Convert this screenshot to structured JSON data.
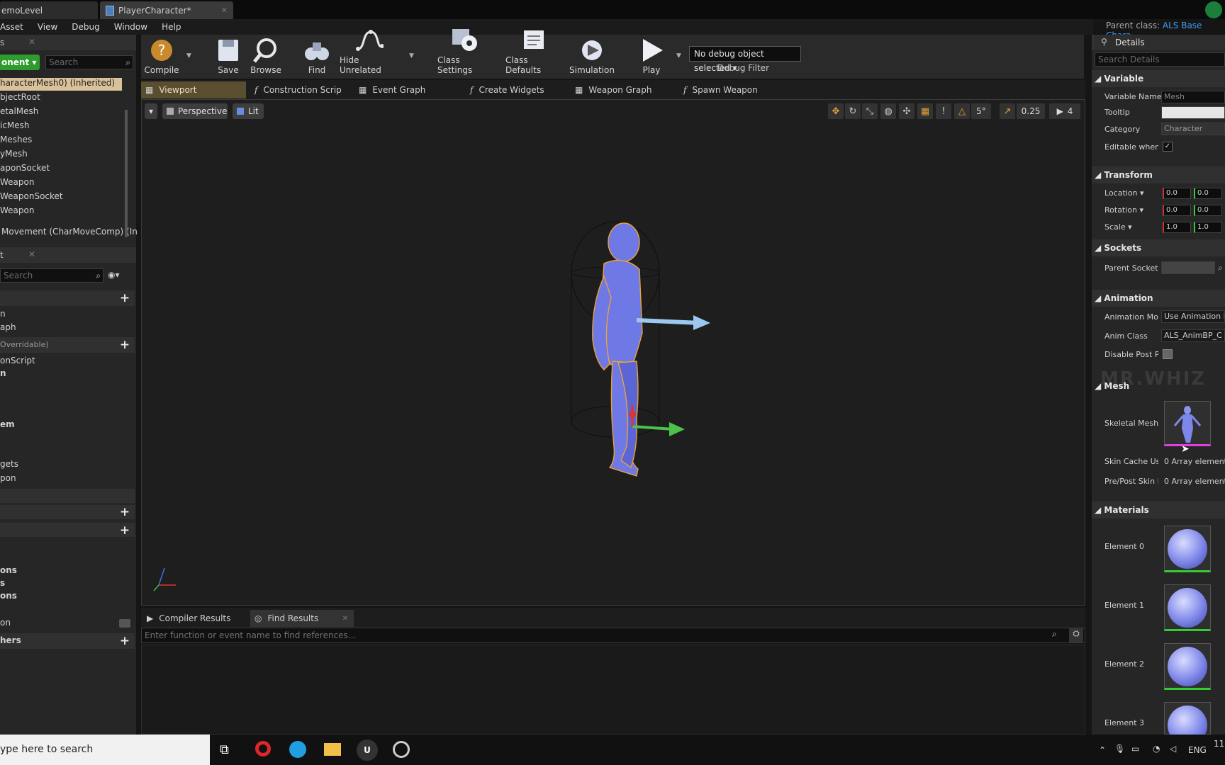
{
  "tabs": {
    "level": "emoLevel",
    "blueprint": "PlayerCharacter*"
  },
  "menu": [
    "Asset",
    "View",
    "Debug",
    "Window",
    "Help"
  ],
  "parent_class": {
    "label": "Parent class:",
    "value": "ALS Base Chara"
  },
  "components": {
    "header": "s",
    "add_button": "onent",
    "search_placeholder": "Search",
    "items": [
      "haracterMesh0) (Inherited)",
      "bjectRoot",
      "etalMesh",
      "icMesh",
      "Meshes",
      "yMesh",
      "aponSocket",
      "Weapon",
      "WeaponSocket",
      "Weapon",
      "Movement (CharMoveComp) (In"
    ]
  },
  "my_blueprint": {
    "header": "t",
    "search_placeholder": "Search",
    "items": [
      "n",
      "aph",
      "Overridable)",
      "onScript",
      "n",
      "em",
      "gets",
      "pon",
      "ons",
      "s",
      "ons",
      "on",
      "hers"
    ]
  },
  "toolbar": {
    "compile": "Compile",
    "save": "Save",
    "browse": "Browse",
    "find": "Find",
    "hide_unrelated": "Hide Unrelated",
    "class_settings": "Class Settings",
    "class_defaults": "Class Defaults",
    "simulation": "Simulation",
    "play": "Play",
    "debug_object": "No debug object selected",
    "debug_filter": "Debug Filter"
  },
  "graph_tabs": [
    "Viewport",
    "Construction Scrip",
    "Event Graph",
    "Create Widgets",
    "Weapon Graph",
    "Spawn Weapon"
  ],
  "viewport": {
    "perspective": "Perspective",
    "lit": "Lit",
    "angle_snap": "5°",
    "scale_snap": "0.25",
    "camera_speed": "4"
  },
  "bottom": {
    "tabs": [
      "Compiler Results",
      "Find Results"
    ],
    "find_placeholder": "Enter function or event name to find references..."
  },
  "details": {
    "title": "Details",
    "search_placeholder": "Search Details",
    "variable": {
      "header": "Variable",
      "name_label": "Variable Name",
      "name_value": "Mesh",
      "tooltip_label": "Tooltip",
      "category_label": "Category",
      "category_value": "Character",
      "editable_label": "Editable when I"
    },
    "transform": {
      "header": "Transform",
      "location_label": "Location",
      "rotation_label": "Rotation",
      "scale_label": "Scale",
      "location": [
        "0.0",
        "0.0"
      ],
      "rotation": [
        "0.0",
        "0.0"
      ],
      "scale": [
        "1.0",
        "1.0"
      ]
    },
    "sockets": {
      "header": "Sockets",
      "parent_label": "Parent Socket"
    },
    "animation": {
      "header": "Animation",
      "mode_label": "Animation Mod",
      "mode_value": "Use Animation B",
      "class_label": "Anim Class",
      "class_value": "ALS_AnimBP_C",
      "post_label": "Disable Post Pr"
    },
    "watermark": "MR.WHIZ",
    "mesh": {
      "header": "Mesh",
      "skeletal_label": "Skeletal Mesh",
      "skin_label": "Skin Cache Usa",
      "skin_value": "0 Array elements",
      "prepost_label": "Pre/Post Skin I",
      "prepost_value": "0 Array elements"
    },
    "materials": {
      "header": "Materials",
      "elements": [
        "Element 0",
        "Element 1",
        "Element 2",
        "Element 3"
      ]
    }
  },
  "taskbar": {
    "search": "ype here to search",
    "lang": "ENG",
    "time": "11:"
  }
}
